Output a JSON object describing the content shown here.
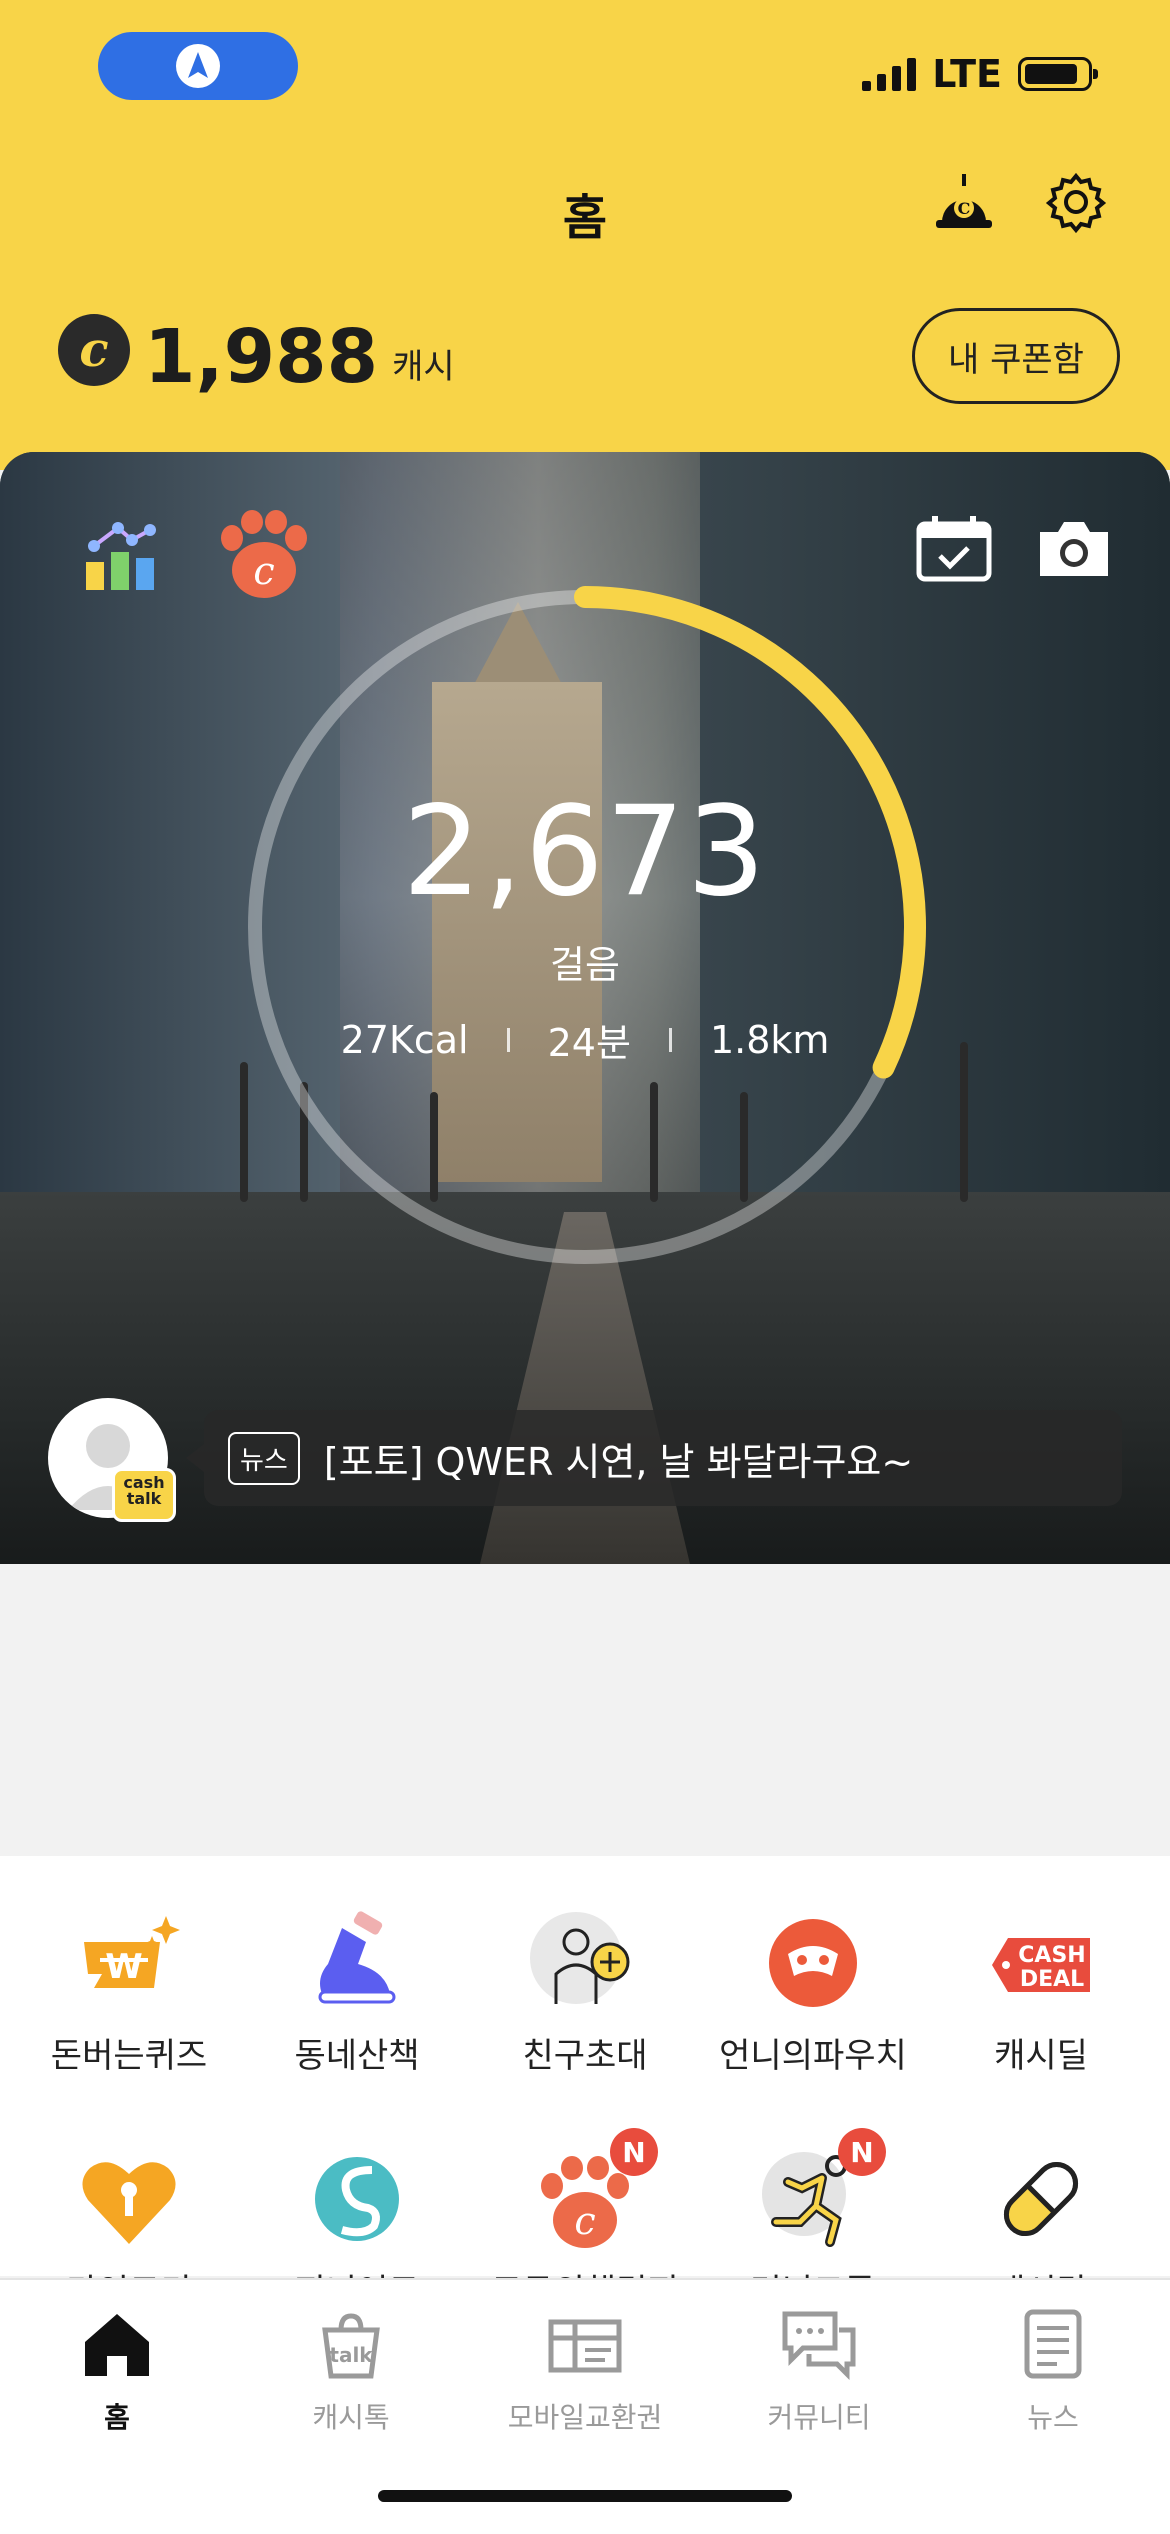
{
  "header": {
    "title": "홈",
    "balance": "1,988",
    "balance_unit": "캐시",
    "coupon_button": "내 쿠폰함"
  },
  "status_bar": {
    "network": "LTE"
  },
  "hero": {
    "steps": "2,673",
    "steps_label": "걸음",
    "calories": "27Kcal",
    "minutes": "24분",
    "distance": "1.8km",
    "step_goal_progress": 0.32,
    "news_tag": "뉴스",
    "news_text": "[포토] QWER 시연, 날 봐달라구요~"
  },
  "menu": [
    {
      "label": "돈버는퀴즈",
      "icon": "quiz-icon"
    },
    {
      "label": "동네산책",
      "icon": "sneaker-icon"
    },
    {
      "label": "친구초대",
      "icon": "invite-friend-icon"
    },
    {
      "label": "언니의파우치",
      "icon": "pouch-icon"
    },
    {
      "label": "캐시딜",
      "icon": "cash-deal-icon"
    },
    {
      "label": "마인드키",
      "icon": "heart-key-icon",
      "badge": ""
    },
    {
      "label": "지니어트",
      "icon": "geniet-icon",
      "badge": ""
    },
    {
      "label": "모두의챌린지",
      "icon": "paw-challenge-icon",
      "badge": "N"
    },
    {
      "label": "러닝크루",
      "icon": "running-icon",
      "badge": "N"
    },
    {
      "label": "캐시닥",
      "icon": "pill-icon",
      "badge": ""
    }
  ],
  "cash_deal_text": [
    "CASH",
    "DEAL"
  ],
  "cashtalk_badge": [
    "cash",
    "talk"
  ],
  "tabs": [
    {
      "label": "홈",
      "icon": "home-icon",
      "active": true
    },
    {
      "label": "캐시톡",
      "icon": "talk-bag-icon"
    },
    {
      "label": "모바일교환권",
      "icon": "gift-voucher-icon"
    },
    {
      "label": "커뮤니티",
      "icon": "chat-bubbles-icon"
    },
    {
      "label": "뉴스",
      "icon": "news-icon"
    }
  ],
  "colors": {
    "brand_yellow": "#f8d448",
    "accent_orange": "#ec6a49",
    "badge_red": "#e84c3d",
    "nav_blue": "#2f6fe4"
  }
}
